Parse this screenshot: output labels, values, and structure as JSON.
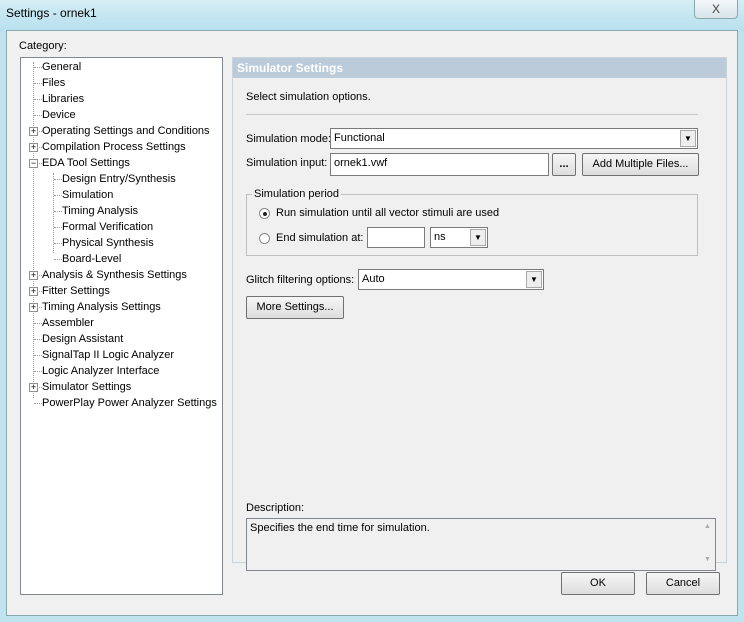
{
  "window": {
    "title": "Settings - ornek1",
    "close_glyph": "X"
  },
  "category_label": "Category:",
  "tree": [
    {
      "label": "General",
      "level": 0,
      "expander": ""
    },
    {
      "label": "Files",
      "level": 0,
      "expander": ""
    },
    {
      "label": "Libraries",
      "level": 0,
      "expander": ""
    },
    {
      "label": "Device",
      "level": 0,
      "expander": ""
    },
    {
      "label": "Operating Settings and Conditions",
      "level": 0,
      "expander": "+"
    },
    {
      "label": "Compilation Process Settings",
      "level": 0,
      "expander": "+"
    },
    {
      "label": "EDA Tool Settings",
      "level": 0,
      "expander": "-"
    },
    {
      "label": "Design Entry/Synthesis",
      "level": 1,
      "expander": ""
    },
    {
      "label": "Simulation",
      "level": 1,
      "expander": ""
    },
    {
      "label": "Timing Analysis",
      "level": 1,
      "expander": ""
    },
    {
      "label": "Formal Verification",
      "level": 1,
      "expander": ""
    },
    {
      "label": "Physical Synthesis",
      "level": 1,
      "expander": ""
    },
    {
      "label": "Board-Level",
      "level": 1,
      "expander": ""
    },
    {
      "label": "Analysis & Synthesis Settings",
      "level": 0,
      "expander": "+"
    },
    {
      "label": "Fitter Settings",
      "level": 0,
      "expander": "+"
    },
    {
      "label": "Timing Analysis Settings",
      "level": 0,
      "expander": "+"
    },
    {
      "label": "Assembler",
      "level": 0,
      "expander": ""
    },
    {
      "label": "Design Assistant",
      "level": 0,
      "expander": ""
    },
    {
      "label": "SignalTap II Logic Analyzer",
      "level": 0,
      "expander": ""
    },
    {
      "label": "Logic Analyzer Interface",
      "level": 0,
      "expander": ""
    },
    {
      "label": "Simulator Settings",
      "level": 0,
      "expander": "+"
    },
    {
      "label": "PowerPlay Power Analyzer Settings",
      "level": 0,
      "expander": ""
    }
  ],
  "panel": {
    "title": "Simulator Settings",
    "intro": "Select simulation options.",
    "mode_label": "Simulation mode:",
    "mode_value": "Functional",
    "input_label": "Simulation input:",
    "input_value": "ornek1.vwf",
    "browse_label": "...",
    "add_multiple_label": "Add Multiple Files...",
    "period_label": "Simulation period",
    "radio_run": "Run simulation until all vector stimuli are used",
    "radio_end": "End simulation at:",
    "end_value": "",
    "unit_value": "ns",
    "selected_radio": "run",
    "glitch_label": "Glitch filtering options:",
    "glitch_value": "Auto",
    "more_settings_label": "More Settings...",
    "description_label": "Description:",
    "description_text": "Specifies the end time for simulation."
  },
  "ok_label": "OK",
  "cancel_label": "Cancel"
}
